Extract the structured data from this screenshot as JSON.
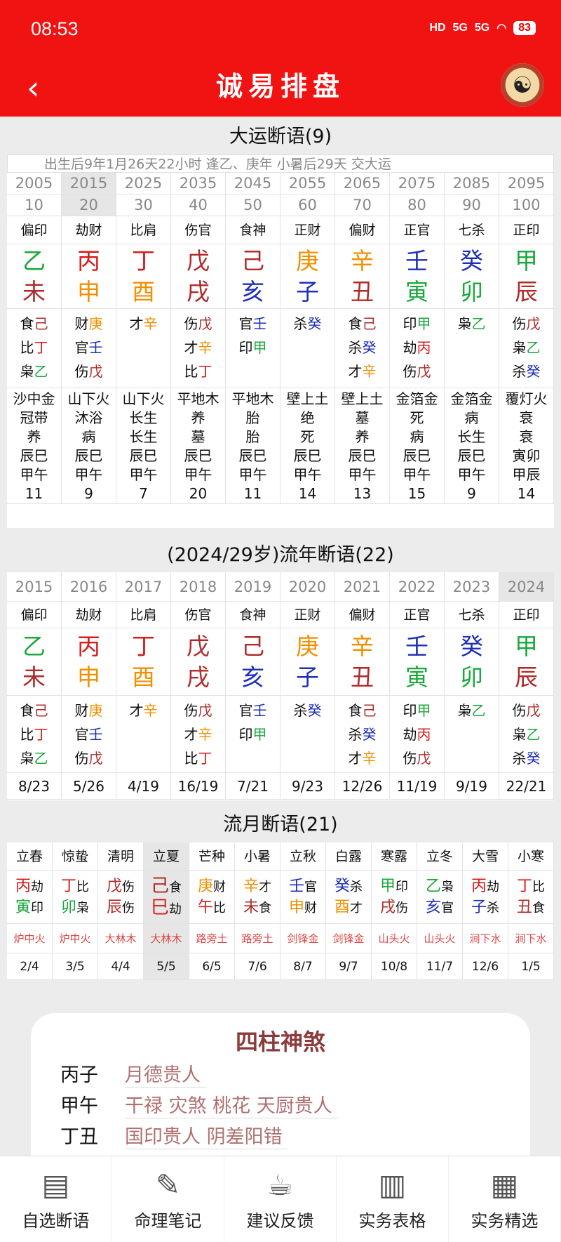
{
  "status": {
    "time": "08:53",
    "hd": "HD",
    "net1": "5G",
    "net2": "5G",
    "battery": "83"
  },
  "header": {
    "title": "诚易排盘",
    "back_icon": "‹",
    "yinyang_icon": "☯"
  },
  "colors": {
    "accent": "#f11212",
    "green": "#1aa83c",
    "red": "#d81b1b",
    "orange": "#f28f00",
    "blue": "#1f2fb8",
    "darkred": "#b02a2a"
  },
  "dayun": {
    "title": "大运断语(9)",
    "subtitle": "出生后9年1月26天22小时  逢乙、庚年 小暑后29天 交大运",
    "selected_index": 1,
    "cols": [
      {
        "year": "2005",
        "age": "10",
        "shishen": "偏印",
        "gan": "乙",
        "gan_c": "c-green",
        "zhi": "未",
        "zhi_c": "c-darkred",
        "hidden": [
          {
            "s": "食",
            "g": "己",
            "c": "c-darkred"
          },
          {
            "s": "比",
            "g": "丁",
            "c": "c-red"
          },
          {
            "s": "枭",
            "g": "乙",
            "c": "c-green"
          }
        ],
        "nayin": "沙中金",
        "l1": "冠带",
        "l2": "养",
        "l3": "辰巳",
        "l4": "甲午",
        "n": "11"
      },
      {
        "year": "2015",
        "age": "20",
        "shishen": "劫财",
        "gan": "丙",
        "gan_c": "c-red",
        "zhi": "申",
        "zhi_c": "c-orange",
        "hidden": [
          {
            "s": "财",
            "g": "庚",
            "c": "c-orange"
          },
          {
            "s": "官",
            "g": "壬",
            "c": "c-blue"
          },
          {
            "s": "伤",
            "g": "戊",
            "c": "c-darkred"
          }
        ],
        "nayin": "山下火",
        "l1": "沐浴",
        "l2": "病",
        "l3": "辰巳",
        "l4": "甲午",
        "n": "9"
      },
      {
        "year": "2025",
        "age": "30",
        "shishen": "比肩",
        "gan": "丁",
        "gan_c": "c-red",
        "zhi": "酉",
        "zhi_c": "c-orange",
        "hidden": [
          {
            "s": "才",
            "g": "辛",
            "c": "c-orange"
          }
        ],
        "nayin": "山下火",
        "l1": "长生",
        "l2": "长生",
        "l3": "辰巳",
        "l4": "甲午",
        "n": "7"
      },
      {
        "year": "2035",
        "age": "40",
        "shishen": "伤官",
        "gan": "戊",
        "gan_c": "c-darkred",
        "zhi": "戌",
        "zhi_c": "c-darkred",
        "hidden": [
          {
            "s": "伤",
            "g": "戊",
            "c": "c-darkred"
          },
          {
            "s": "才",
            "g": "辛",
            "c": "c-orange"
          },
          {
            "s": "比",
            "g": "丁",
            "c": "c-red"
          }
        ],
        "nayin": "平地木",
        "l1": "养",
        "l2": "墓",
        "l3": "辰巳",
        "l4": "甲午",
        "n": "20"
      },
      {
        "year": "2045",
        "age": "50",
        "shishen": "食神",
        "gan": "己",
        "gan_c": "c-darkred",
        "zhi": "亥",
        "zhi_c": "c-blue",
        "hidden": [
          {
            "s": "官",
            "g": "壬",
            "c": "c-blue"
          },
          {
            "s": "印",
            "g": "甲",
            "c": "c-green"
          }
        ],
        "nayin": "平地木",
        "l1": "胎",
        "l2": "胎",
        "l3": "辰巳",
        "l4": "甲午",
        "n": "11"
      },
      {
        "year": "2055",
        "age": "60",
        "shishen": "正财",
        "gan": "庚",
        "gan_c": "c-orange",
        "zhi": "子",
        "zhi_c": "c-blue",
        "hidden": [
          {
            "s": "杀",
            "g": "癸",
            "c": "c-blue"
          }
        ],
        "nayin": "壁上土",
        "l1": "绝",
        "l2": "死",
        "l3": "辰巳",
        "l4": "甲午",
        "n": "14"
      },
      {
        "year": "2065",
        "age": "70",
        "shishen": "偏财",
        "gan": "辛",
        "gan_c": "c-orange",
        "zhi": "丑",
        "zhi_c": "c-darkred",
        "hidden": [
          {
            "s": "食",
            "g": "己",
            "c": "c-darkred"
          },
          {
            "s": "杀",
            "g": "癸",
            "c": "c-blue"
          },
          {
            "s": "才",
            "g": "辛",
            "c": "c-orange"
          }
        ],
        "nayin": "壁上土",
        "l1": "墓",
        "l2": "养",
        "l3": "辰巳",
        "l4": "甲午",
        "n": "13"
      },
      {
        "year": "2075",
        "age": "80",
        "shishen": "正官",
        "gan": "壬",
        "gan_c": "c-blue",
        "zhi": "寅",
        "zhi_c": "c-green",
        "hidden": [
          {
            "s": "印",
            "g": "甲",
            "c": "c-green"
          },
          {
            "s": "劫",
            "g": "丙",
            "c": "c-red"
          },
          {
            "s": "伤",
            "g": "戊",
            "c": "c-darkred"
          }
        ],
        "nayin": "金箔金",
        "l1": "死",
        "l2": "病",
        "l3": "辰巳",
        "l4": "甲午",
        "n": "15"
      },
      {
        "year": "2085",
        "age": "90",
        "shishen": "七杀",
        "gan": "癸",
        "gan_c": "c-blue",
        "zhi": "卯",
        "zhi_c": "c-green",
        "hidden": [
          {
            "s": "枭",
            "g": "乙",
            "c": "c-green"
          }
        ],
        "nayin": "金箔金",
        "l1": "病",
        "l2": "长生",
        "l3": "辰巳",
        "l4": "甲午",
        "n": "9"
      },
      {
        "year": "2095",
        "age": "100",
        "shishen": "正印",
        "gan": "甲",
        "gan_c": "c-green",
        "zhi": "辰",
        "zhi_c": "c-darkred",
        "hidden": [
          {
            "s": "伤",
            "g": "戊",
            "c": "c-darkred"
          },
          {
            "s": "枭",
            "g": "乙",
            "c": "c-green"
          },
          {
            "s": "杀",
            "g": "癸",
            "c": "c-blue"
          }
        ],
        "nayin": "覆灯火",
        "l1": "衰",
        "l2": "衰",
        "l3": "寅卯",
        "l4": "甲辰",
        "n": "14"
      }
    ]
  },
  "liunian": {
    "title": "(2024/29岁)流年断语(22)",
    "selected_index": 9,
    "cols": [
      {
        "year": "2015",
        "shishen": "偏印",
        "gan": "乙",
        "gan_c": "c-green",
        "zhi": "未",
        "zhi_c": "c-darkred",
        "hidden": [
          {
            "s": "食",
            "g": "己",
            "c": "c-darkred"
          },
          {
            "s": "比",
            "g": "丁",
            "c": "c-red"
          },
          {
            "s": "枭",
            "g": "乙",
            "c": "c-green"
          }
        ],
        "n": "8/23"
      },
      {
        "year": "2016",
        "shishen": "劫财",
        "gan": "丙",
        "gan_c": "c-red",
        "zhi": "申",
        "zhi_c": "c-orange",
        "hidden": [
          {
            "s": "财",
            "g": "庚",
            "c": "c-orange"
          },
          {
            "s": "官",
            "g": "壬",
            "c": "c-blue"
          },
          {
            "s": "伤",
            "g": "戊",
            "c": "c-darkred"
          }
        ],
        "n": "5/26"
      },
      {
        "year": "2017",
        "shishen": "比肩",
        "gan": "丁",
        "gan_c": "c-red",
        "zhi": "酉",
        "zhi_c": "c-orange",
        "hidden": [
          {
            "s": "才",
            "g": "辛",
            "c": "c-orange"
          }
        ],
        "n": "4/19"
      },
      {
        "year": "2018",
        "shishen": "伤官",
        "gan": "戊",
        "gan_c": "c-darkred",
        "zhi": "戌",
        "zhi_c": "c-darkred",
        "hidden": [
          {
            "s": "伤",
            "g": "戊",
            "c": "c-darkred"
          },
          {
            "s": "才",
            "g": "辛",
            "c": "c-orange"
          },
          {
            "s": "比",
            "g": "丁",
            "c": "c-red"
          }
        ],
        "n": "16/19"
      },
      {
        "year": "2019",
        "shishen": "食神",
        "gan": "己",
        "gan_c": "c-darkred",
        "zhi": "亥",
        "zhi_c": "c-blue",
        "hidden": [
          {
            "s": "官",
            "g": "壬",
            "c": "c-blue"
          },
          {
            "s": "印",
            "g": "甲",
            "c": "c-green"
          }
        ],
        "n": "7/21"
      },
      {
        "year": "2020",
        "shishen": "正财",
        "gan": "庚",
        "gan_c": "c-orange",
        "zhi": "子",
        "zhi_c": "c-blue",
        "hidden": [
          {
            "s": "杀",
            "g": "癸",
            "c": "c-blue"
          }
        ],
        "n": "9/23"
      },
      {
        "year": "2021",
        "shishen": "偏财",
        "gan": "辛",
        "gan_c": "c-orange",
        "zhi": "丑",
        "zhi_c": "c-darkred",
        "hidden": [
          {
            "s": "食",
            "g": "己",
            "c": "c-darkred"
          },
          {
            "s": "杀",
            "g": "癸",
            "c": "c-blue"
          },
          {
            "s": "才",
            "g": "辛",
            "c": "c-orange"
          }
        ],
        "n": "12/26"
      },
      {
        "year": "2022",
        "shishen": "正官",
        "gan": "壬",
        "gan_c": "c-blue",
        "zhi": "寅",
        "zhi_c": "c-green",
        "hidden": [
          {
            "s": "印",
            "g": "甲",
            "c": "c-green"
          },
          {
            "s": "劫",
            "g": "丙",
            "c": "c-red"
          },
          {
            "s": "伤",
            "g": "戊",
            "c": "c-darkred"
          }
        ],
        "n": "11/19"
      },
      {
        "year": "2023",
        "shishen": "七杀",
        "gan": "癸",
        "gan_c": "c-blue",
        "zhi": "卯",
        "zhi_c": "c-green",
        "hidden": [
          {
            "s": "枭",
            "g": "乙",
            "c": "c-green"
          }
        ],
        "n": "9/19"
      },
      {
        "year": "2024",
        "shishen": "正印",
        "gan": "甲",
        "gan_c": "c-green",
        "zhi": "辰",
        "zhi_c": "c-darkred",
        "hidden": [
          {
            "s": "伤",
            "g": "戊",
            "c": "c-darkred"
          },
          {
            "s": "枭",
            "g": "乙",
            "c": "c-green"
          },
          {
            "s": "杀",
            "g": "癸",
            "c": "c-blue"
          }
        ],
        "n": "22/21"
      }
    ]
  },
  "liuyue": {
    "title": "流月断语(21)",
    "selected_index": 3,
    "cols": [
      {
        "jieqi": "立春",
        "gan": "丙",
        "gan_c": "c-red",
        "gs": "劫",
        "zhi": "寅",
        "zhi_c": "c-green",
        "zs": "印",
        "nayin": "炉中火",
        "date": "2/4"
      },
      {
        "jieqi": "惊蛰",
        "gan": "丁",
        "gan_c": "c-red",
        "gs": "比",
        "zhi": "卯",
        "zhi_c": "c-green",
        "zs": "枭",
        "nayin": "炉中火",
        "date": "3/5"
      },
      {
        "jieqi": "清明",
        "gan": "戊",
        "gan_c": "c-darkred",
        "gs": "伤",
        "zhi": "辰",
        "zhi_c": "c-darkred",
        "zs": "伤",
        "nayin": "大林木",
        "date": "4/4"
      },
      {
        "jieqi": "立夏",
        "gan": "己",
        "gan_c": "c-darkred",
        "gs": "食",
        "zhi": "巳",
        "zhi_c": "c-red",
        "zs": "劫",
        "nayin": "大林木",
        "date": "5/5"
      },
      {
        "jieqi": "芒种",
        "gan": "庚",
        "gan_c": "c-orange",
        "gs": "财",
        "zhi": "午",
        "zhi_c": "c-red",
        "zs": "比",
        "nayin": "路旁土",
        "date": "6/5"
      },
      {
        "jieqi": "小暑",
        "gan": "辛",
        "gan_c": "c-orange",
        "gs": "才",
        "zhi": "未",
        "zhi_c": "c-darkred",
        "zs": "食",
        "nayin": "路旁土",
        "date": "7/6"
      },
      {
        "jieqi": "立秋",
        "gan": "壬",
        "gan_c": "c-blue",
        "gs": "官",
        "zhi": "申",
        "zhi_c": "c-orange",
        "zs": "财",
        "nayin": "剑锋金",
        "date": "8/7"
      },
      {
        "jieqi": "白露",
        "gan": "癸",
        "gan_c": "c-blue",
        "gs": "杀",
        "zhi": "酉",
        "zhi_c": "c-orange",
        "zs": "才",
        "nayin": "剑锋金",
        "date": "9/7"
      },
      {
        "jieqi": "寒露",
        "gan": "甲",
        "gan_c": "c-green",
        "gs": "印",
        "zhi": "戌",
        "zhi_c": "c-darkred",
        "zs": "伤",
        "nayin": "山头火",
        "date": "10/8"
      },
      {
        "jieqi": "立冬",
        "gan": "乙",
        "gan_c": "c-green",
        "gs": "枭",
        "zhi": "亥",
        "zhi_c": "c-blue",
        "zs": "官",
        "nayin": "山头火",
        "date": "11/7"
      },
      {
        "jieqi": "大雪",
        "gan": "丙",
        "gan_c": "c-red",
        "gs": "劫",
        "zhi": "子",
        "zhi_c": "c-blue",
        "zs": "杀",
        "nayin": "涧下水",
        "date": "12/6"
      },
      {
        "jieqi": "小寒",
        "gan": "丁",
        "gan_c": "c-red",
        "gs": "比",
        "zhi": "丑",
        "zhi_c": "c-darkred",
        "zs": "食",
        "nayin": "涧下水",
        "date": "1/5"
      }
    ]
  },
  "shensha": {
    "title": "四柱神煞",
    "rows": [
      {
        "pillar": "丙子",
        "stars": "月德贵人"
      },
      {
        "pillar": "甲午",
        "stars": "干禄 灾煞 桃花 天厨贵人"
      },
      {
        "pillar": "丁丑",
        "stars": "国印贵人 阴差阳错"
      }
    ]
  },
  "tabbar": [
    {
      "label": "自选断语",
      "icon": "document-icon",
      "glyph": "▤"
    },
    {
      "label": "命理笔记",
      "icon": "edit-icon",
      "glyph": "✎"
    },
    {
      "label": "建议反馈",
      "icon": "coffee-icon",
      "glyph": "☕"
    },
    {
      "label": "实务表格",
      "icon": "chart-icon",
      "glyph": "▥"
    },
    {
      "label": "实务精选",
      "icon": "notepad-icon",
      "glyph": "▦"
    }
  ]
}
